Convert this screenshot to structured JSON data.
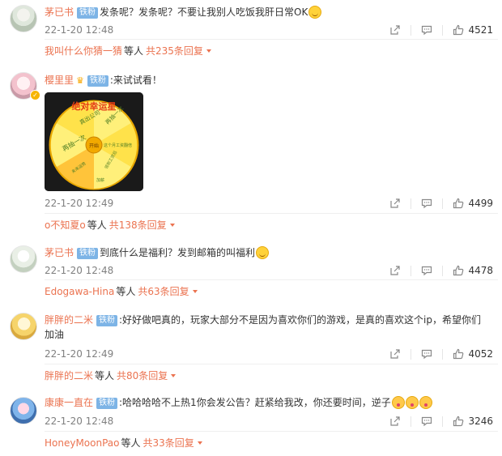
{
  "comments": [
    {
      "username": "茅已书",
      "badge": "铁粉",
      "text": "发条呢？发条呢？不要让我别人吃饭我肝日常OK",
      "emojis": [
        "smile-emoji"
      ],
      "time": "22-1-20 12:48",
      "likes": "4521",
      "reply": {
        "user": "我叫什么你猜一猜",
        "etc": "等人",
        "count": "共235条回复"
      }
    },
    {
      "username": "樱里里",
      "badge": "铁粉",
      "text": ":来试试看！",
      "image": {
        "title": "绝对幸运星",
        "segments": [
          "真出公司",
          "再抽一次",
          "再抽一次",
          "这个月工资翻倍",
          "领到工资后",
          "未来运势",
          "加薪"
        ],
        "center": "开始"
      },
      "time": "22-1-20 12:49",
      "likes": "4499",
      "reply": {
        "user": "o不知夏o",
        "etc": "等人",
        "count": "共138条回复"
      }
    },
    {
      "username": "茅已书",
      "badge": "铁粉",
      "text": "到底什么是福利？发到邮箱的叫福利",
      "emojis": [
        "smile-emoji"
      ],
      "time": "22-1-20 12:48",
      "likes": "4478",
      "reply": {
        "user": "Edogawa-Hina",
        "etc": "等人",
        "count": "共63条回复"
      }
    },
    {
      "username": "胖胖的二米",
      "badge": "铁粉",
      "text": ":好好做吧真的，玩家大部分不是因为喜欢你们的游戏，是真的喜欢这个ip，希望你们加油",
      "time": "22-1-20 12:49",
      "likes": "4052",
      "reply": {
        "user": "胖胖的二米",
        "etc": "等人",
        "count": "共80条回复"
      }
    },
    {
      "username": "康康一直在",
      "badge": "铁粉",
      "text": ":哈哈哈哈不上热1你会发公告？赶紧给我改，你还要时间，逆子",
      "emojis": [
        "kiss-emoji",
        "kiss-emoji",
        "kiss-emoji"
      ],
      "time": "22-1-20 12:48",
      "likes": "3246",
      "reply": {
        "user": "HoneyMoonPao",
        "etc": "等人",
        "count": "共33条回复"
      }
    }
  ],
  "icons": {
    "share": "share-icon",
    "comment": "comment-icon",
    "like": "like-icon",
    "reply_more": "chevron-down-icon"
  },
  "colors": {
    "username": "#eb7350",
    "badge": "#7db4e6",
    "time": "#808080",
    "divider": "#efefef"
  }
}
